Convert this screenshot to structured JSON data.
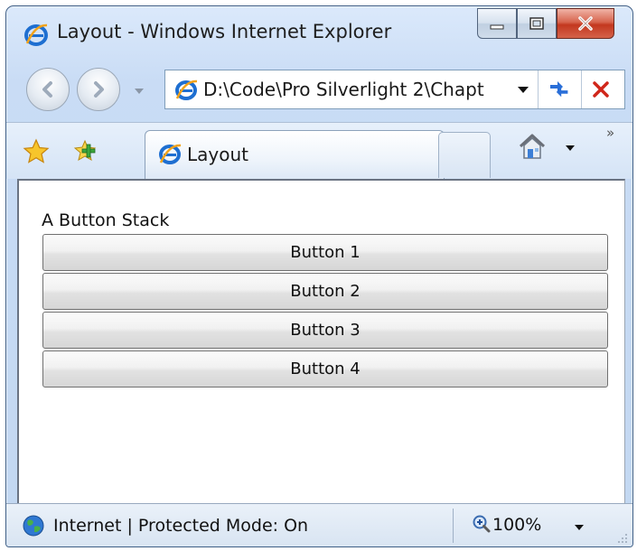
{
  "window": {
    "title": "Layout - Windows Internet Explorer"
  },
  "nav": {
    "address": "D:\\Code\\Pro Silverlight 2\\Chapt"
  },
  "tabs": [
    {
      "label": "Layout"
    }
  ],
  "content": {
    "stack_title": "A Button Stack",
    "buttons": [
      {
        "label": "Button 1"
      },
      {
        "label": "Button 2"
      },
      {
        "label": "Button 3"
      },
      {
        "label": "Button 4"
      }
    ]
  },
  "status": {
    "zone": "Internet | Protected Mode: On",
    "zoom": "100%"
  },
  "colors": {
    "ie_blue": "#1e6fd1",
    "ie_orange": "#f2a31b",
    "close_red": "#c3371f",
    "stop_red": "#d0261a",
    "refresh_blue": "#2a6fd8"
  },
  "icons": [
    "ie-logo-icon",
    "minimize-icon",
    "maximize-icon",
    "close-icon",
    "back-icon",
    "forward-icon",
    "refresh-icon",
    "stop-icon",
    "star-icon",
    "add-favorite-icon",
    "home-icon",
    "globe-icon",
    "zoom-icon",
    "resize-grip-icon"
  ]
}
